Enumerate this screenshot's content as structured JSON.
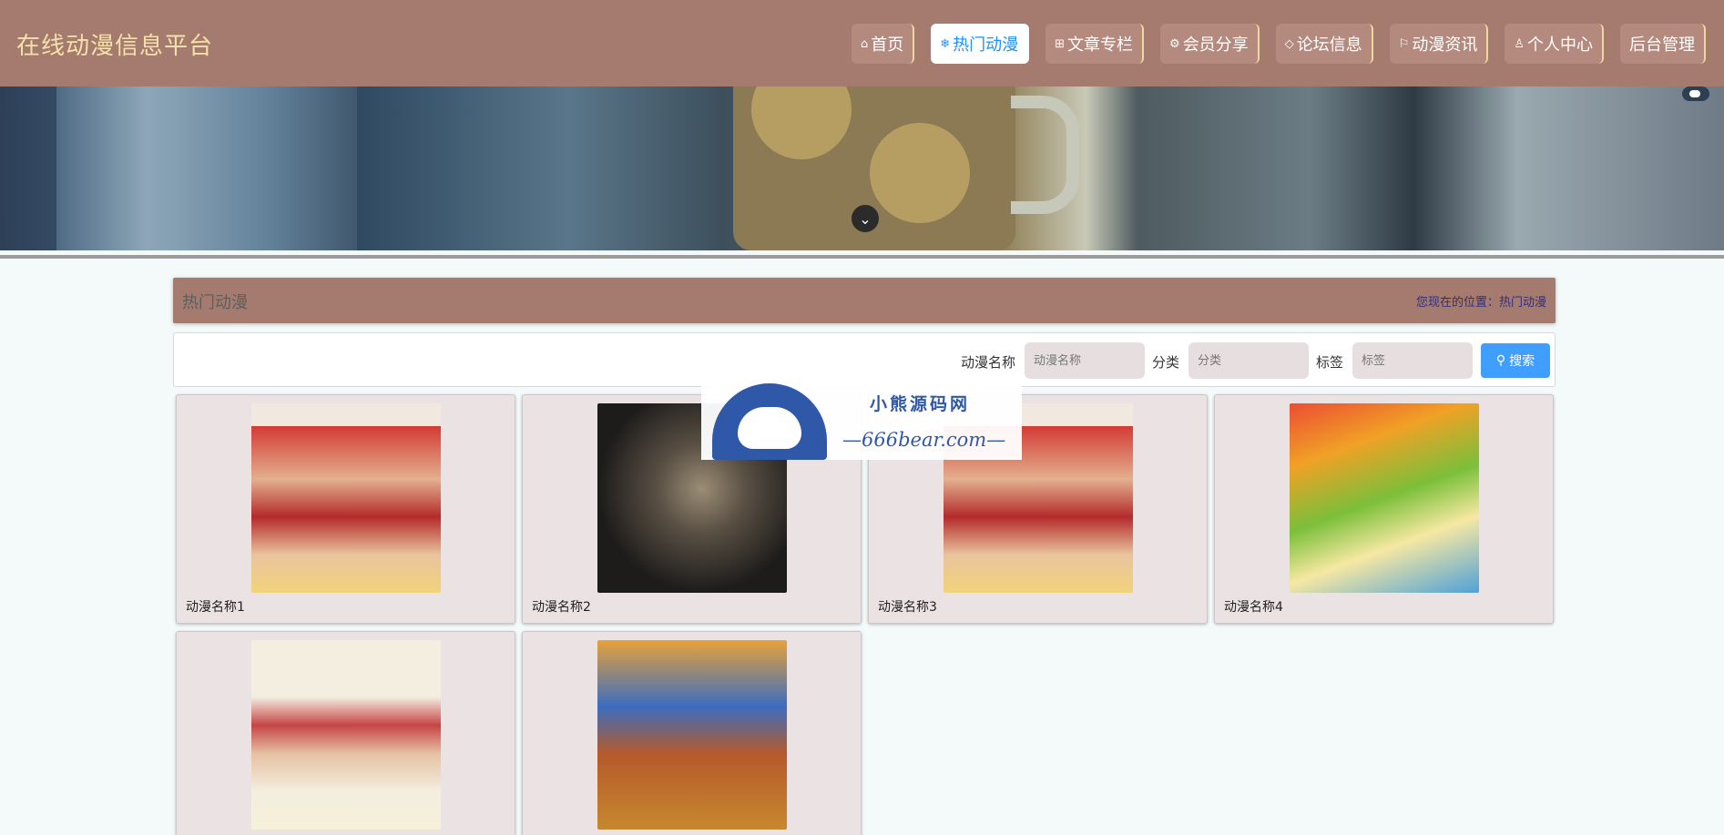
{
  "header": {
    "site_title": "在线动漫信息平台",
    "nav": [
      {
        "icon": "home-icon",
        "glyph": "⌂",
        "label": "首页",
        "active": false
      },
      {
        "icon": "snowflake-icon",
        "glyph": "❄",
        "label": "热门动漫",
        "active": true
      },
      {
        "icon": "grid-icon",
        "glyph": "⊞",
        "label": "文章专栏",
        "active": false
      },
      {
        "icon": "gift-icon",
        "glyph": "⚙",
        "label": "会员分享",
        "active": false
      },
      {
        "icon": "tag-icon",
        "glyph": "◇",
        "label": "论坛信息",
        "active": false
      },
      {
        "icon": "flag-icon",
        "glyph": "⚐",
        "label": "动漫资讯",
        "active": false
      },
      {
        "icon": "user-icon",
        "glyph": "♙",
        "label": "个人中心",
        "active": false
      },
      {
        "icon": "",
        "glyph": "",
        "label": "后台管理",
        "active": false
      }
    ]
  },
  "banner": {
    "scroll_glyph": "⌄"
  },
  "page": {
    "title": "热门动漫",
    "location_text": "您现在的位置：热门动漫"
  },
  "search": {
    "name_label": "动漫名称",
    "name_placeholder": "动漫名称",
    "category_label": "分类",
    "category_placeholder": "分类",
    "tag_label": "标签",
    "tag_placeholder": "标签",
    "button_label": "搜索"
  },
  "cards": [
    {
      "name": "动漫名称1",
      "image": "slam-dunk-poster"
    },
    {
      "name": "动漫名称2",
      "image": "gundam-figure"
    },
    {
      "name": "动漫名称3",
      "image": "slam-dunk-poster"
    },
    {
      "name": "动漫名称4",
      "image": "crayon-shinchan-poster"
    },
    {
      "name": "",
      "image": "slam-dunk-team-poster"
    },
    {
      "name": "",
      "image": "one-piece-poster"
    }
  ],
  "watermark": {
    "title": "小熊源码网",
    "url": "—666bear.com—"
  }
}
